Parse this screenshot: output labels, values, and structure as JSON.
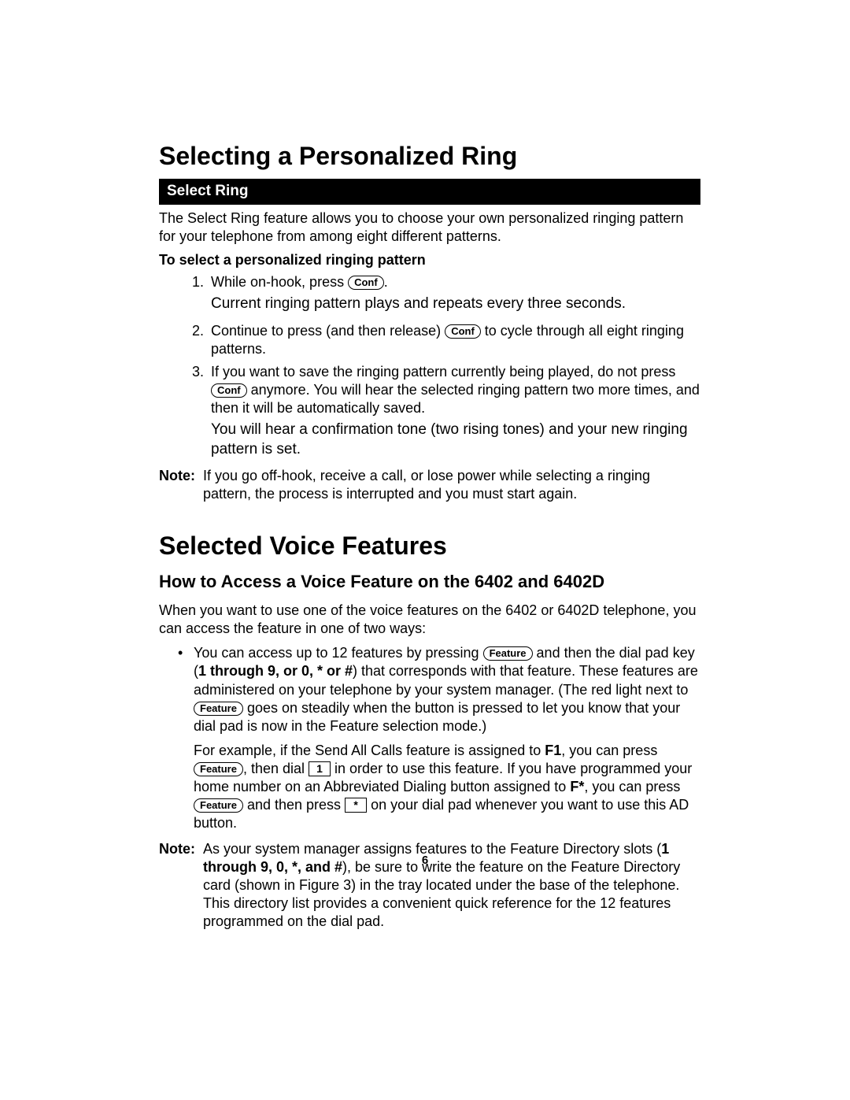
{
  "section1": {
    "title": "Selecting a Personalized Ring",
    "bar": "Select Ring",
    "intro": "The Select Ring feature allows you to choose your own personalized ringing pattern for your telephone from among eight different patterns.",
    "procTitle": "To select a personalized ringing pattern",
    "step1_a": "While on-hook, press ",
    "step1_b": ".",
    "result1": "Current ringing pattern plays and repeats every three seconds.",
    "step2_a": "Continue to press (and then release) ",
    "step2_b": " to cycle through all eight ringing patterns.",
    "step3_a": "If you want to save the ringing pattern currently being played, do not press ",
    "step3_b": " anymore. You will hear the selected ringing pattern two more times, and then it will be automatically saved.",
    "result3": "You will hear a confirmation tone (two rising tones) and your new ringing pattern is set.",
    "noteLabel": "Note:",
    "note": "If you go off-hook, receive a call, or lose power while selecting a ringing pattern, the process is interrupted and you must start again."
  },
  "section2": {
    "title": "Selected Voice Features",
    "subtitle": "How to Access a Voice Feature on the 6402 and 6402D",
    "intro": "When you want to use one of the voice features on the 6402 or 6402D telephone, you can access the feature in one of two ways:",
    "bullet1_a": "You can access up to 12 features by pressing ",
    "bullet1_b": " and then the dial pad key (",
    "bullet1_bold1": "1 through 9, or 0, * or #",
    "bullet1_c": ") that corresponds with that feature. These features are administered on your telephone by your system manager. (The red light next to ",
    "bullet1_d": " goes on steadily when the button is pressed to let you know that your dial pad is now in the Feature selection mode.)",
    "bullet1p2_a": "For example, if the Send All Calls feature is assigned to ",
    "bullet1p2_bold1": "F1",
    "bullet1p2_b": ", you can press ",
    "bullet1p2_c": ", then dial ",
    "bullet1p2_d": " in order to use this feature. If you have programmed your home number on an Abbreviated Dialing button assigned to ",
    "bullet1p2_bold2": "F*",
    "bullet1p2_e": ", you can press ",
    "bullet1p2_f": " and then press ",
    "bullet1p2_g": " on your dial pad whenever you want to use this AD button.",
    "noteLabel": "Note:",
    "note_a": "As your system manager assigns features to the Feature Directory slots (",
    "note_bold": "1 through 9, 0, *, and #",
    "note_b": "), be sure to write the feature on the Feature Directory card (shown in Figure 3) in the tray located under the base of the telephone. This directory list provides a convenient quick reference for the 12 features programmed on the dial pad."
  },
  "buttons": {
    "conf": "Conf",
    "feature": "Feature",
    "one": "1",
    "star": "*"
  },
  "pageNumber": "6"
}
